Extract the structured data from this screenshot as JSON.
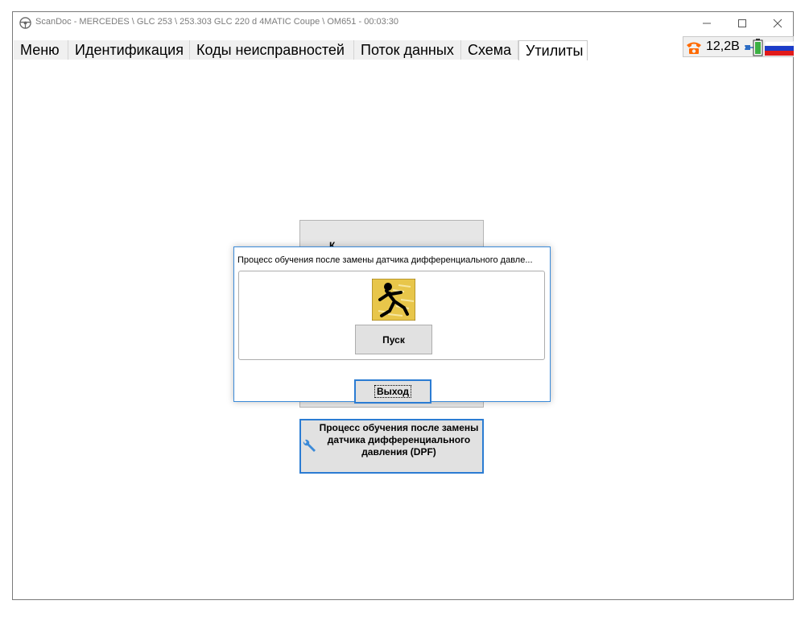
{
  "window": {
    "title": "ScanDoc - MERCEDES \\ GLC 253 \\ 253.303 GLC 220 d 4MATIC Coupe \\ OM651 - 00:03:30",
    "minimize_glyph": "—",
    "maximize_glyph": "☐",
    "close_glyph": "✕"
  },
  "tabs": [
    {
      "label": "Меню"
    },
    {
      "label": "Идентификация"
    },
    {
      "label": "Коды неисправностей"
    },
    {
      "label": "Поток данных"
    },
    {
      "label": "Схема"
    },
    {
      "label": "Утилиты",
      "active": true
    }
  ],
  "status": {
    "voltage": "12,2В",
    "icons": [
      "phone-icon",
      "plug-icon",
      "battery-icon",
      "russia-flag-icon"
    ]
  },
  "background_panel": {
    "label": "К"
  },
  "procedure_button": {
    "label": "Процесс обучения после замены датчика дифференциального давления (DPF)",
    "icon": "wrench-icon"
  },
  "dialog": {
    "title": "Процесс обучения после замены датчика дифференциального давле...",
    "icon": "running-man-icon",
    "start_label": "Пуск",
    "exit_label": "Выход"
  },
  "colors": {
    "accent": "#2b7cd3",
    "tab_bg": "#f0f0f0",
    "button_bg": "#e1e1e1",
    "phone": "#ff6a00"
  }
}
